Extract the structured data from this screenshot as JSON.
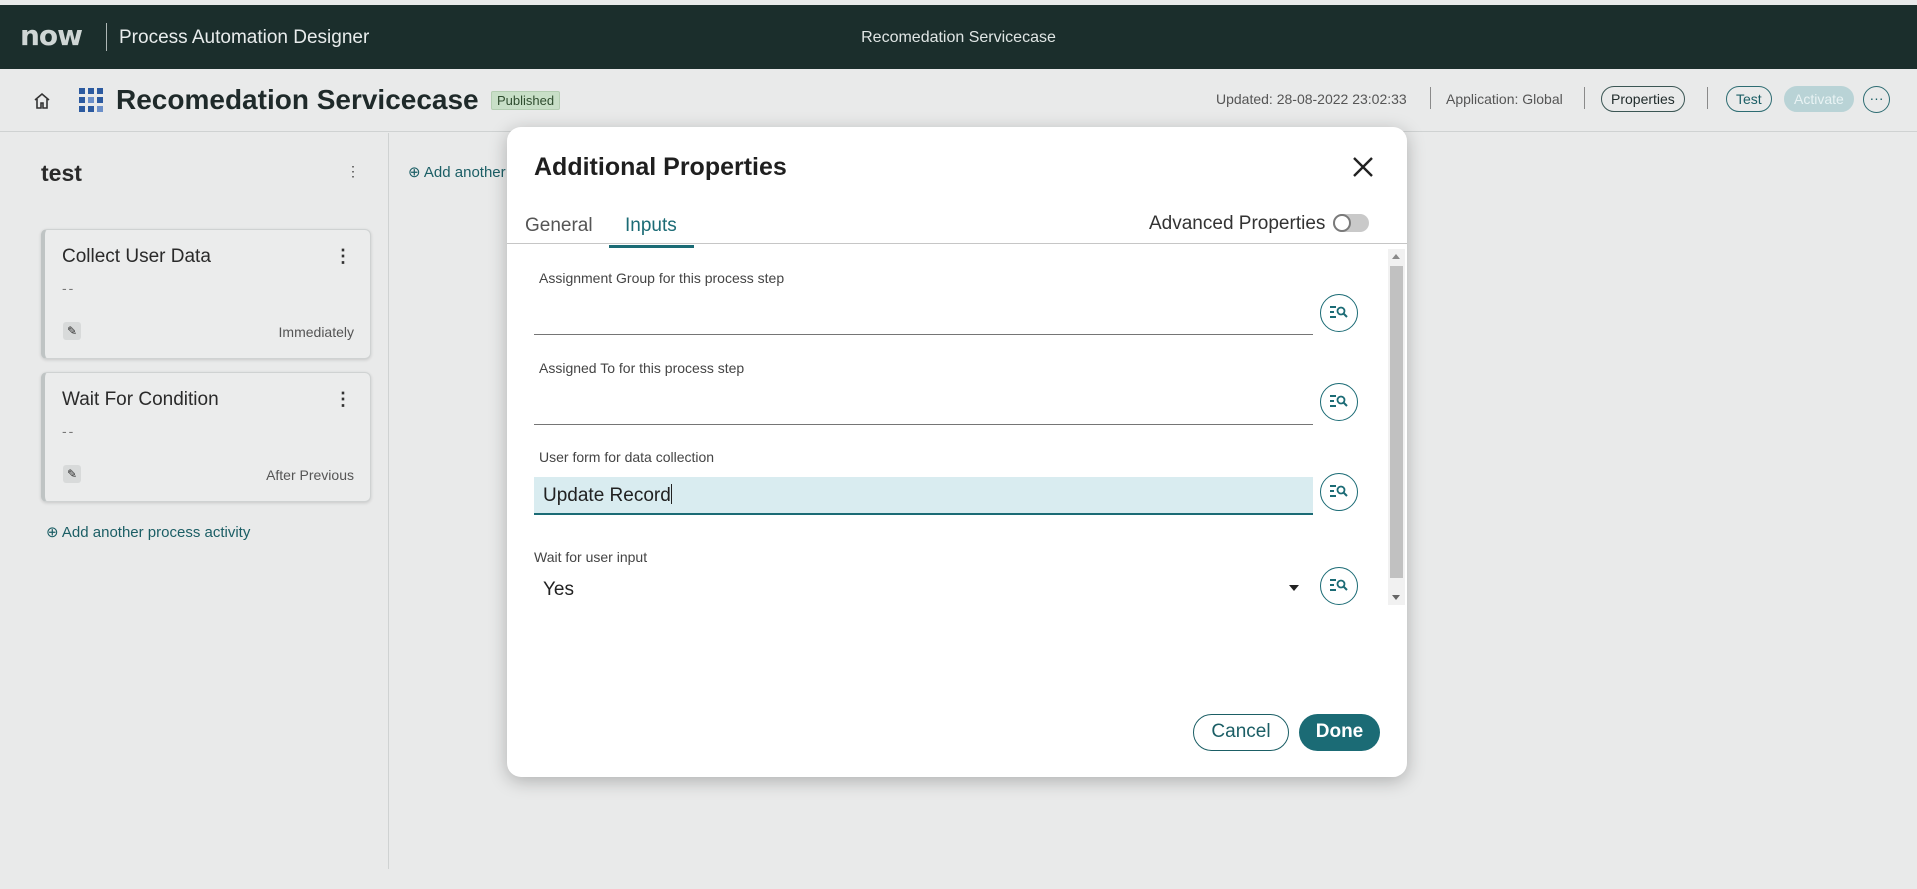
{
  "topbar": {
    "logo": "now",
    "app_name": "Process Automation Designer",
    "center_title": "Recomedation Servicecase"
  },
  "header": {
    "title": "Recomedation Servicecase",
    "status_badge": "Published",
    "updated": "Updated:  28-08-2022 23:02:33",
    "application": "Application: Global",
    "properties_label": "Properties",
    "test_label": "Test",
    "activate_label": "Activate",
    "more_label": "···"
  },
  "stage": {
    "title": "test",
    "menu": "⋮",
    "add_another_partial": "⊕ Add another",
    "cards": [
      {
        "title": "Collect User Data",
        "description": "--",
        "timing": "Immediately"
      },
      {
        "title": "Wait For Condition",
        "description": "--",
        "timing": "After Previous"
      }
    ],
    "add_activity": "⊕ Add another process activity"
  },
  "modal": {
    "title": "Additional Properties",
    "tabs": [
      {
        "label": "General"
      },
      {
        "label": "Inputs"
      }
    ],
    "active_tab": "Inputs",
    "advanced_label": "Advanced Properties",
    "advanced_enabled": false,
    "fields": [
      {
        "label": "Assignment Group for this process step",
        "value": ""
      },
      {
        "label": "Assigned To for this process step",
        "value": ""
      },
      {
        "label": "User form for data collection",
        "value": "Update Record"
      },
      {
        "label": "Wait for user input",
        "value": "Yes"
      }
    ],
    "cancel_label": "Cancel",
    "done_label": "Done"
  },
  "colors": {
    "topbar_bg": "#1b2e2c",
    "accent": "#1b6b75",
    "page_bg": "#e9eaea",
    "active_field_bg": "#d9ecf0"
  },
  "icons": [
    "home-icon",
    "flow-designer-icon",
    "close-icon",
    "data-pill-picker-icon",
    "edit-icon",
    "more-vertical-icon",
    "chevron-down-icon",
    "plus-circle-icon"
  ]
}
